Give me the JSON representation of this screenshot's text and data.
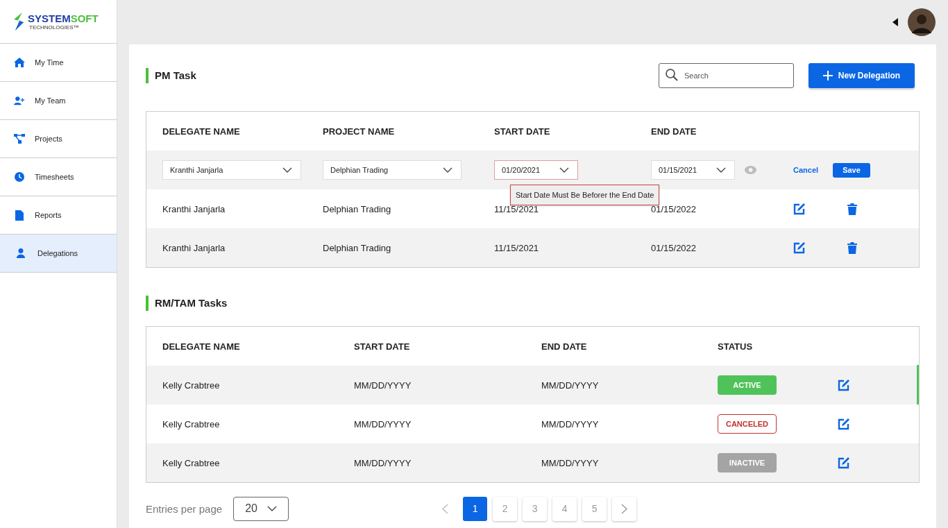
{
  "logo": {
    "part_1": "SYSTEM",
    "part_2": "SOFT",
    "tagline": "TECHNOLOGIES™"
  },
  "sidebar": {
    "items": [
      {
        "label": "My Time",
        "selected": false
      },
      {
        "label": "My Team",
        "selected": false
      },
      {
        "label": "Projects",
        "selected": false
      },
      {
        "label": "Timesheets",
        "selected": false
      },
      {
        "label": "Reports",
        "selected": false
      },
      {
        "label": "Delegations",
        "selected": true
      }
    ]
  },
  "pm_task": {
    "title": "PM Task",
    "search": {
      "placeholder": "Search"
    },
    "new_button": "New Delegation",
    "columns": [
      "DELEGATE NAME",
      "PROJECT NAME",
      "START DATE",
      "END DATE"
    ],
    "edit_row": {
      "delegate": "Kranthi Janjarla",
      "project": "Delphian Trading",
      "start": "01/20/2021",
      "end": "01/15/2021",
      "start_invalid": true,
      "error": "Start Date Must Be Beforer the End Date",
      "cancel": "Cancel",
      "save": "Save"
    },
    "rows": [
      {
        "delegate": "Kranthi Janjarla",
        "project": "Delphian Trading",
        "start": "11/15/2021",
        "end": "01/15/2022"
      },
      {
        "delegate": "Kranthi Janjarla",
        "project": "Delphian Trading",
        "start": "11/15/2021",
        "end": "01/15/2022"
      }
    ]
  },
  "rm_tasks": {
    "title": "RM/TAM Tasks",
    "columns": [
      "DELEGATE NAME",
      "START DATE",
      "END DATE",
      "STATUS"
    ],
    "rows": [
      {
        "delegate": "Kelly Crabtree",
        "start": "MM/DD/YYYY",
        "end": "MM/DD/YYYY",
        "status": "ACTIVE",
        "kind": "active"
      },
      {
        "delegate": "Kelly Crabtree",
        "start": "MM/DD/YYYY",
        "end": "MM/DD/YYYY",
        "status": "CANCELED",
        "kind": "canceled"
      },
      {
        "delegate": "Kelly Crabtree",
        "start": "MM/DD/YYYY",
        "end": "MM/DD/YYYY",
        "status": "INACTIVE",
        "kind": "inactive"
      }
    ]
  },
  "pagination": {
    "label": "Entries per page",
    "page_size": "20",
    "pages": [
      {
        "label": "1",
        "selected": true
      },
      {
        "label": "2",
        "selected": false
      },
      {
        "label": "3",
        "selected": false
      },
      {
        "label": "4",
        "selected": false
      },
      {
        "label": "5",
        "selected": false
      }
    ]
  }
}
